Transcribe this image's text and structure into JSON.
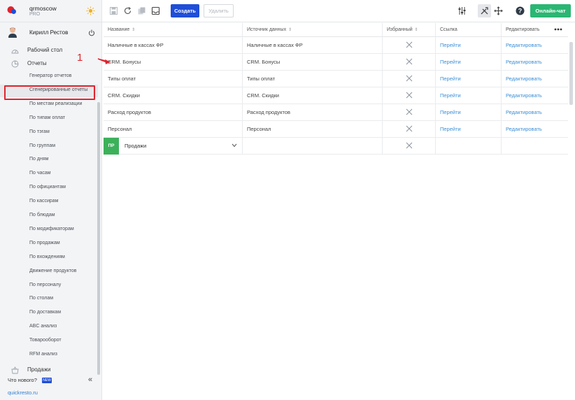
{
  "brand": {
    "name": "qrmoscow",
    "plan": "PRO"
  },
  "user": {
    "name": "Кирилл Рестов"
  },
  "nav": {
    "desktop": "Рабочий стол",
    "reports": "Отчеты",
    "sales": "Продажи"
  },
  "submenu": [
    "Генератор отчетов",
    "Сгенерированные отчеты",
    "По местам реализации",
    "По типам оплат",
    "По тэгам",
    "По группам",
    "По дням",
    "По часам",
    "По официантам",
    "По кассирам",
    "По блюдам",
    "По модификаторам",
    "По продажам",
    "По вхождениям",
    "Движение продуктов",
    "По персоналу",
    "По столам",
    "По доставкам",
    "ABC анализ",
    "Товарооборот",
    "RFM анализ"
  ],
  "active_submenu_index": 1,
  "footer": {
    "whats_new": "Что нового?",
    "new_badge": "NEW",
    "site": "quickresto.ru"
  },
  "toolbar": {
    "create": "Создать",
    "delete": "Удалить",
    "chat": "Онлайн-чат"
  },
  "table": {
    "headers": {
      "name": "Название",
      "source": "Источник данных",
      "favorite": "Избранный",
      "link": "Ссылка",
      "edit": "Редактировать"
    },
    "rows": [
      {
        "name": "Наличные в кассах ФР",
        "source": "Наличные в кассах ФР",
        "link": "Перейти",
        "edit": "Редактировать"
      },
      {
        "name": "CRM. Бонусы",
        "source": "CRM. Бонусы",
        "link": "Перейти",
        "edit": "Редактировать"
      },
      {
        "name": "Типы оплат",
        "source": "Типы оплат",
        "link": "Перейти",
        "edit": "Редактировать"
      },
      {
        "name": "CRM. Скидки",
        "source": "CRM. Скидки",
        "link": "Перейти",
        "edit": "Редактировать"
      },
      {
        "name": "Расход продуктов",
        "source": "Расход продуктов",
        "link": "Перейти",
        "edit": "Редактировать"
      },
      {
        "name": "Персонал",
        "source": "Персонал",
        "link": "Перейти",
        "edit": "Редактировать"
      }
    ],
    "new_row": {
      "badge": "ПР",
      "selected": "Продажи"
    }
  },
  "annotation": {
    "number": "1"
  },
  "colors": {
    "accent": "#1f4ed8",
    "chat": "#2bb673",
    "link": "#3d8fd6",
    "highlight": "#e0242e",
    "badge": "#3cb15a"
  }
}
